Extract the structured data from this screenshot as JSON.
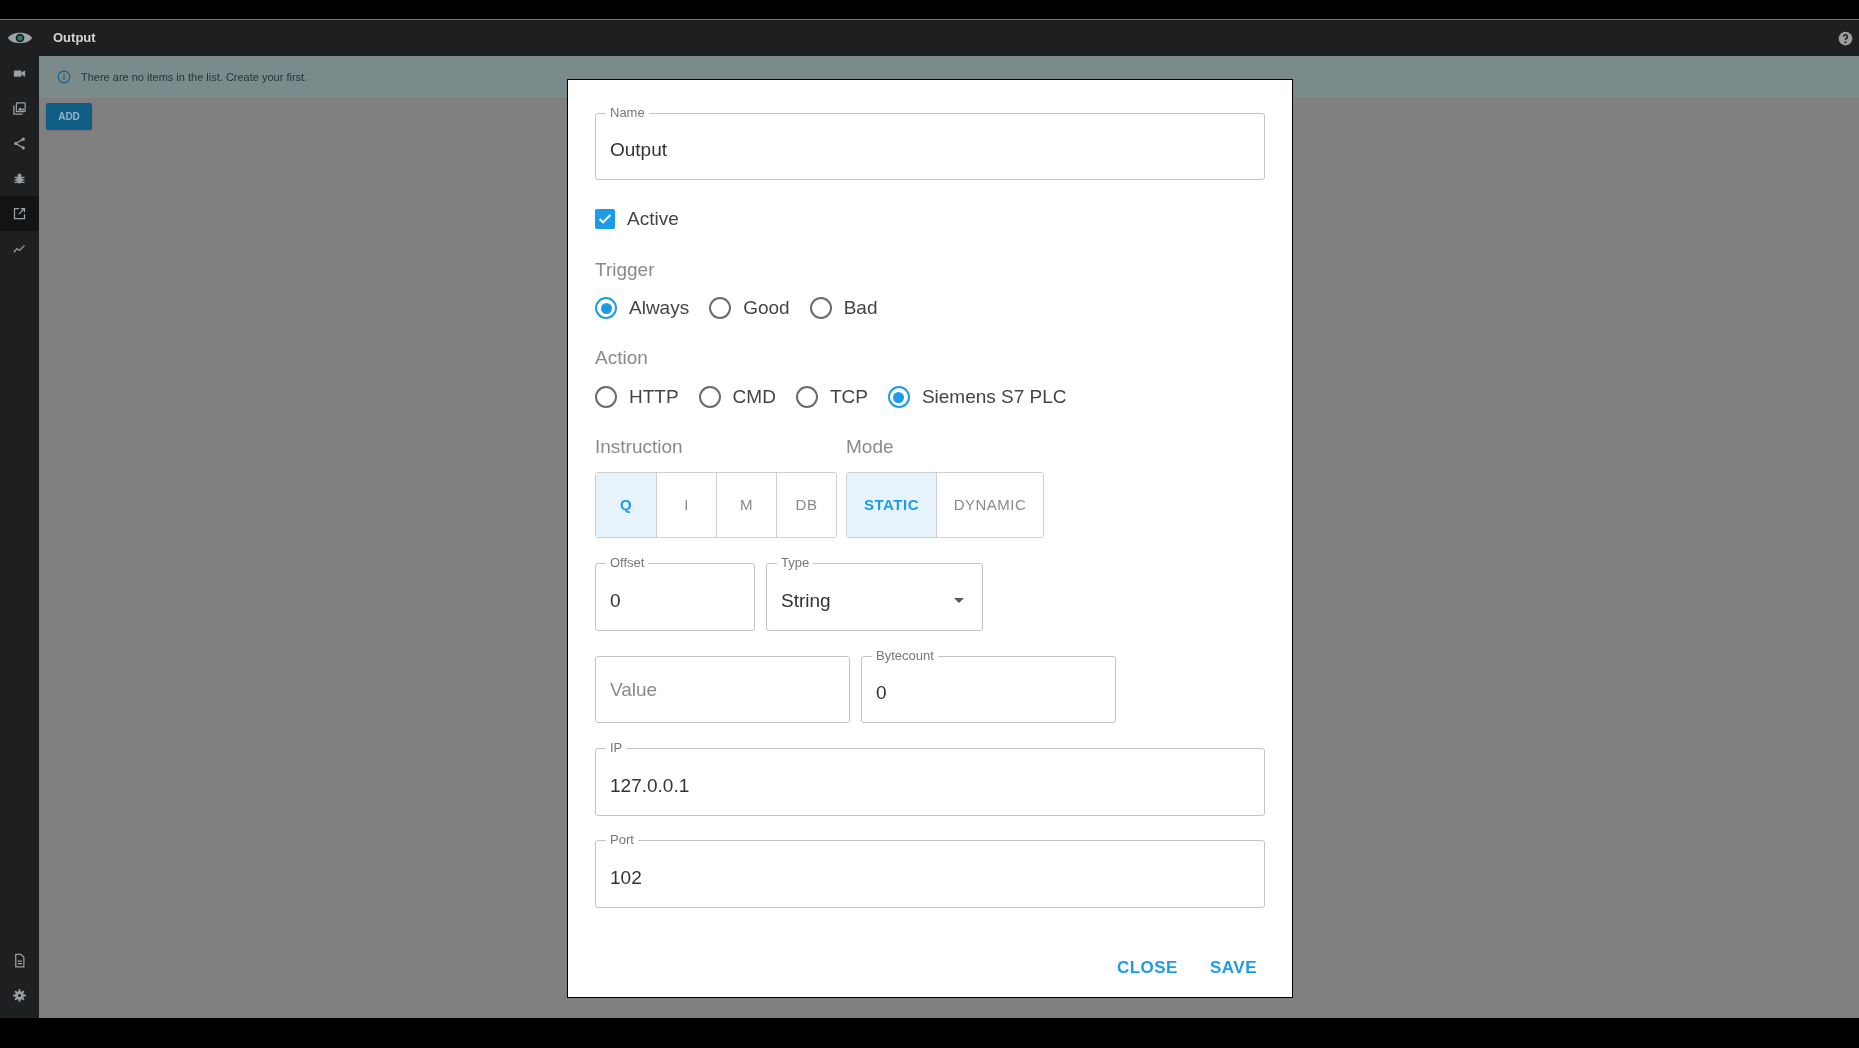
{
  "header": {
    "title": "Output"
  },
  "sidebar": {
    "items": [
      {
        "kind": "camera",
        "selected": false
      },
      {
        "kind": "images",
        "selected": false
      },
      {
        "kind": "share",
        "selected": false
      },
      {
        "kind": "bug",
        "selected": false
      },
      {
        "kind": "export",
        "selected": true
      },
      {
        "kind": "chart",
        "selected": false
      }
    ],
    "bottom_items": [
      {
        "kind": "document",
        "selected": false
      },
      {
        "kind": "settings",
        "selected": false
      }
    ]
  },
  "info_banner": {
    "text": "There are no items in the list. Create your first."
  },
  "add_button": "ADD",
  "dialog": {
    "name": {
      "label": "Name",
      "value": "Output"
    },
    "active": {
      "label": "Active",
      "checked": true
    },
    "trigger": {
      "label": "Trigger",
      "options": [
        {
          "label": "Always",
          "selected": true
        },
        {
          "label": "Good",
          "selected": false
        },
        {
          "label": "Bad",
          "selected": false
        }
      ]
    },
    "action": {
      "label": "Action",
      "options": [
        {
          "label": "HTTP",
          "selected": false
        },
        {
          "label": "CMD",
          "selected": false
        },
        {
          "label": "TCP",
          "selected": false
        },
        {
          "label": "Siemens S7 PLC",
          "selected": true
        }
      ]
    },
    "instruction": {
      "label": "Instruction",
      "options": [
        {
          "label": "Q",
          "selected": true
        },
        {
          "label": "I",
          "selected": false
        },
        {
          "label": "M",
          "selected": false
        },
        {
          "label": "DB",
          "selected": false
        }
      ]
    },
    "mode": {
      "label": "Mode",
      "options": [
        {
          "label": "STATIC",
          "selected": true
        },
        {
          "label": "DYNAMIC",
          "selected": false
        }
      ]
    },
    "offset": {
      "label": "Offset",
      "value": "0"
    },
    "type": {
      "label": "Type",
      "value": "String"
    },
    "value": {
      "placeholder": "Value"
    },
    "bytecount": {
      "label": "Bytecount",
      "value": "0"
    },
    "ip": {
      "label": "IP",
      "value": "127.0.0.1"
    },
    "port": {
      "label": "Port",
      "value": "102"
    },
    "buttons": [
      "CLOSE",
      "SAVE"
    ]
  }
}
